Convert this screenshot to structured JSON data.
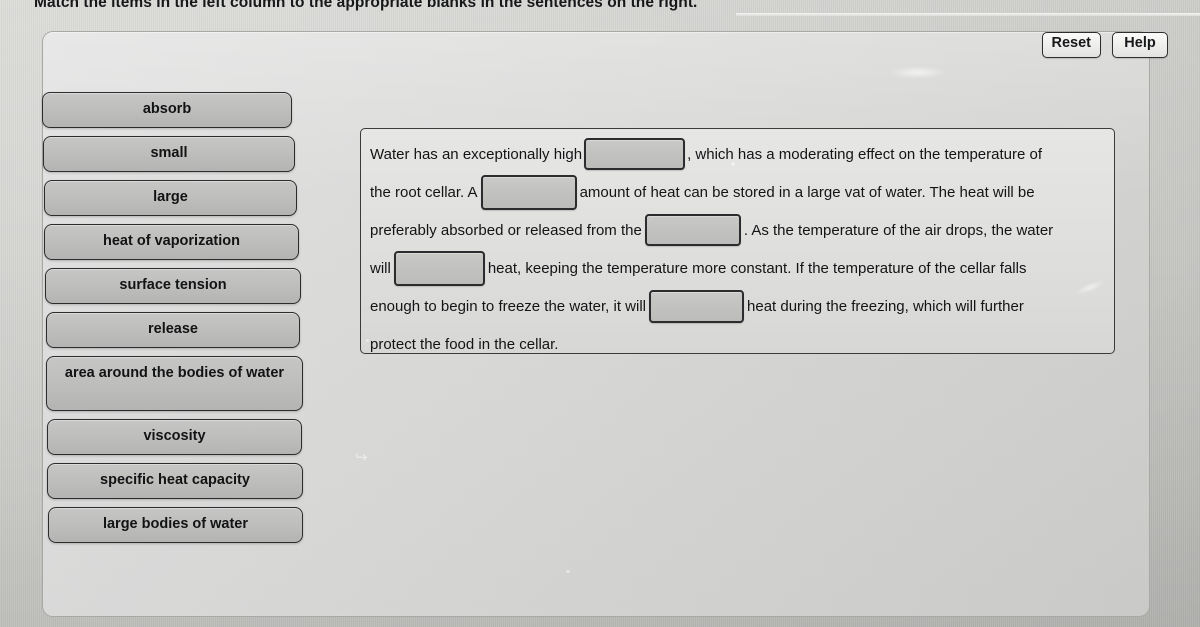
{
  "header": {
    "instruction": "Match the items in the left column to the appropriate blanks in the sentences on the right."
  },
  "toolbar": {
    "reset_label": "Reset",
    "help_label": "Help"
  },
  "item_bank": {
    "items": [
      {
        "label": "absorb"
      },
      {
        "label": "small"
      },
      {
        "label": "large"
      },
      {
        "label": "heat of vaporization"
      },
      {
        "label": "surface tension"
      },
      {
        "label": "release"
      },
      {
        "label": "area around the bodies of water"
      },
      {
        "label": "viscosity"
      },
      {
        "label": "specific heat capacity"
      },
      {
        "label": "large bodies of water"
      }
    ]
  },
  "sentence_panel": {
    "lines": [
      {
        "before": "Water has an exceptionally high",
        "blank": {
          "value": "",
          "filled": false
        },
        "after": ", which has a moderating effect on the temperature of"
      },
      {
        "before": "the root cellar. A",
        "blank": {
          "value": "",
          "filled": false
        },
        "after": "amount of heat can be stored in a large vat of water. The heat will be"
      },
      {
        "before": "preferably absorbed or released from the",
        "blank": {
          "value": "",
          "filled": false
        },
        "after": ". As the temperature of the air drops, the water"
      },
      {
        "before": "will",
        "blank": {
          "value": "",
          "filled": false
        },
        "after": "heat, keeping the temperature more constant. If the temperature of the cellar falls"
      },
      {
        "before": "enough to begin to freeze the water, it will",
        "blank": {
          "value": "",
          "filled": false
        },
        "after": "heat during the freezing, which will further"
      },
      {
        "before": "protect the food in the cellar.",
        "blank": null,
        "after": ""
      }
    ]
  },
  "colors": {
    "page_background": "#d2d2cf",
    "panel_background": "#d6d6d4",
    "item_fill": "#bdbdbb",
    "blank_fill": "#c1c1bf",
    "border_dark": "#2b2c2e",
    "text": "#131415"
  }
}
